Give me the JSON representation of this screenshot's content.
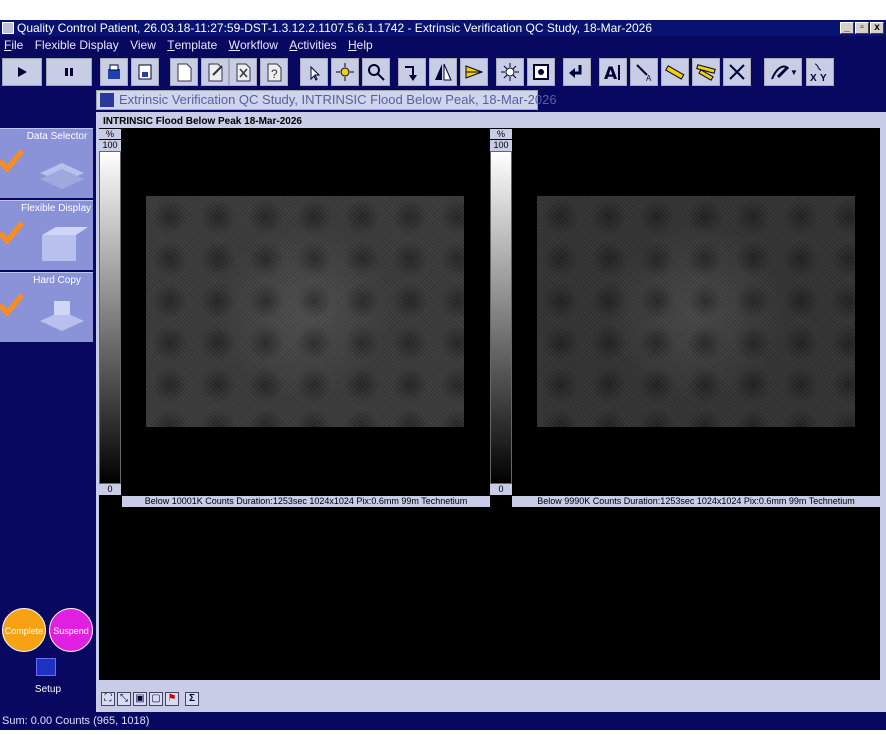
{
  "window": {
    "title": "Quality Control Patient, 26.03.18-11:27:59-DST-1.3.12.2.1107.5.6.1.1742 - Extrinsic Verification QC Study, 18-Mar-2026",
    "minimize": "_",
    "restore": "▫",
    "close": "x"
  },
  "menu": [
    {
      "key": "F",
      "rest": "ile"
    },
    {
      "key": "",
      "rest": "Flexible Display"
    },
    {
      "key": "",
      "rest": "View"
    },
    {
      "key": "T",
      "rest": "emplate"
    },
    {
      "key": "W",
      "rest": "orkflow"
    },
    {
      "key": "A",
      "rest": "ctivities"
    },
    {
      "key": "H",
      "rest": "elp"
    }
  ],
  "nav": {
    "items": [
      {
        "label": "Data Selector",
        "checked": true
      },
      {
        "label": "Flexible Display",
        "checked": true
      },
      {
        "label": "Hard Copy",
        "checked": true
      }
    ],
    "complete_label": "Complete",
    "suspend_label": "Suspend",
    "setup_label": "Setup"
  },
  "tab": {
    "label": "Extrinsic Verification QC Study, INTRINSIC Flood Below Peak, 18-Mar-2026"
  },
  "panel": {
    "title": "INTRINSIC Flood Below Peak 18-Mar-2026",
    "images": [
      {
        "scale_unit": "%",
        "scale_max": "100",
        "scale_min": "0",
        "caption": "Below 10001K Counts Duration:1253sec 1024x1024 Pix:0.6mm 99m Technetium"
      },
      {
        "scale_unit": "%",
        "scale_max": "100",
        "scale_min": "0",
        "caption": "Below 9990K Counts Duration:1253sec 1024x1024 Pix:0.6mm 99m Technetium"
      }
    ]
  },
  "bottom_tools": {
    "sigma": "Σ"
  },
  "status": {
    "text": "Sum: 0.00 Counts (965, 1018)"
  },
  "toolbar_ab_text": "AI",
  "xy_label_x": "X",
  "xy_label_y": "Y",
  "colors": {
    "dark_navy": "#080860",
    "panel": "#c8cce6",
    "nav_card": "#8b93d8",
    "check": "#ff8c1a",
    "complete": "#f7a215",
    "suspend": "#e020e0"
  }
}
